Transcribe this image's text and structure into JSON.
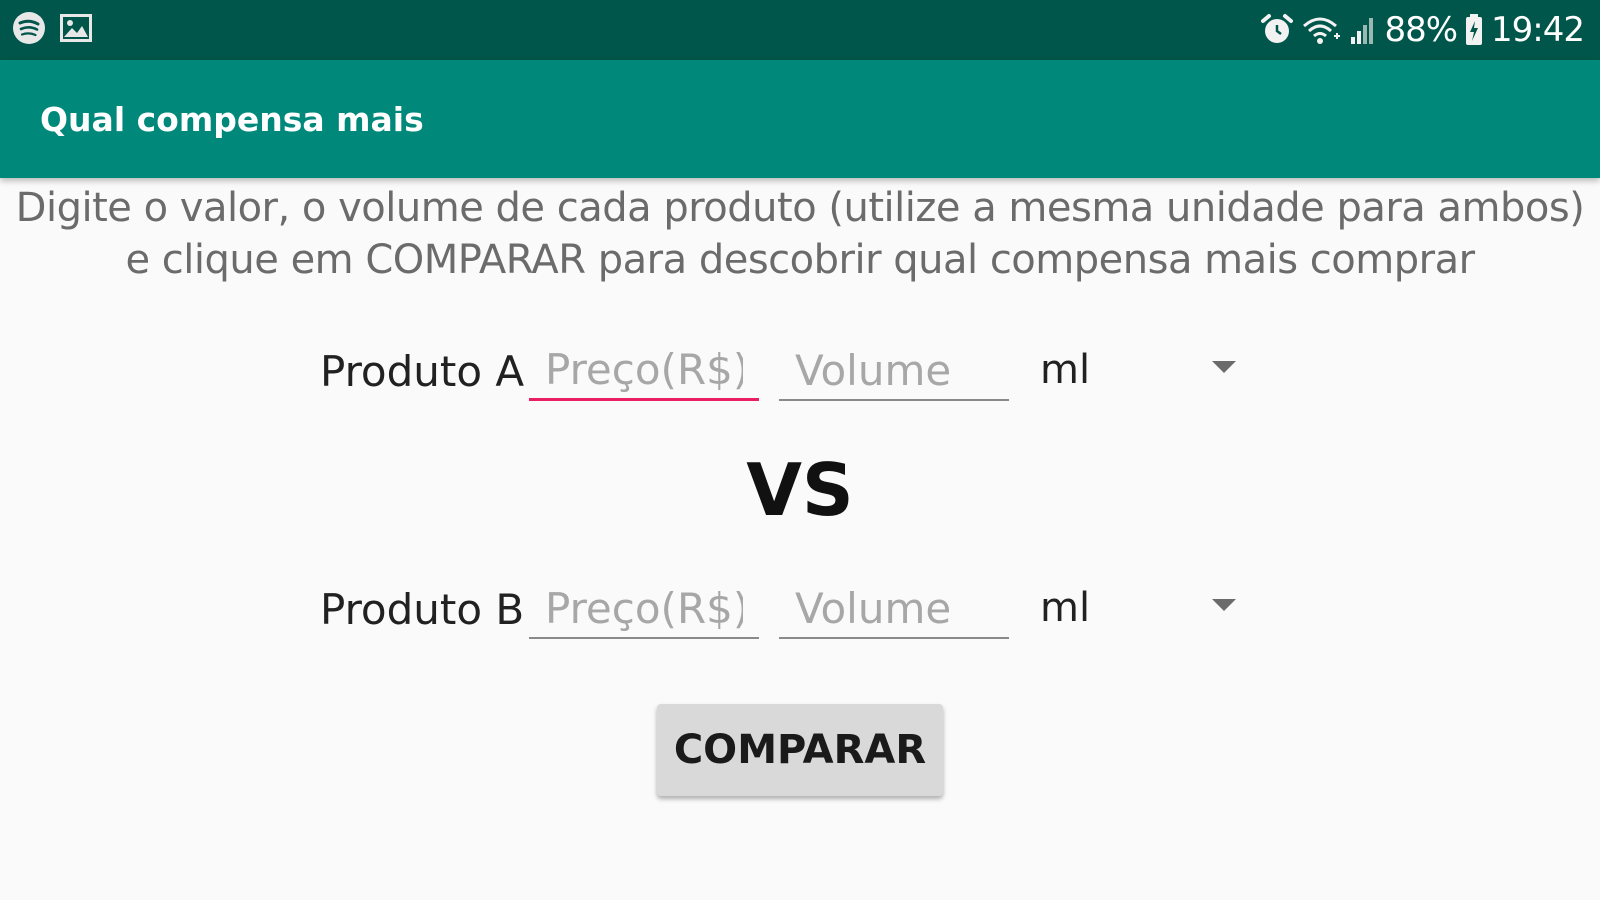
{
  "status_bar": {
    "left_icons": [
      "spotify-icon",
      "gallery-icon"
    ],
    "right_icons": [
      "alarm-icon",
      "wifi-icon",
      "signal-icon",
      "battery-icon"
    ],
    "battery_percent": "88%",
    "time": "19:42",
    "bg_color": "#00564a"
  },
  "app_bar": {
    "title": "Qual compensa mais",
    "bg_color": "#00897b"
  },
  "instructions": {
    "line1": "Digite o valor, o volume de cada produto (utilize a mesma unidade para ambos)",
    "line2": "e clique em COMPARAR para descobrir qual compensa mais comprar"
  },
  "product_a": {
    "label": "Produto A",
    "price": {
      "value": "",
      "placeholder": "Preço(R$)"
    },
    "volume": {
      "value": "",
      "placeholder": "Volume"
    },
    "unit": "ml",
    "dropdown_icon": "arrow-drop-down-icon"
  },
  "vs_label": "VS",
  "product_b": {
    "label": "Produto B",
    "price": {
      "value": "",
      "placeholder": "Preço(R$)"
    },
    "volume": {
      "value": "",
      "placeholder": "Volume"
    },
    "unit": "ml",
    "dropdown_icon": "arrow-drop-down-icon"
  },
  "compare_button": {
    "label": "COMPARAR"
  },
  "colors": {
    "accent": "#e91e63",
    "background": "#fafafa",
    "button_bg": "#d9d9d9"
  }
}
